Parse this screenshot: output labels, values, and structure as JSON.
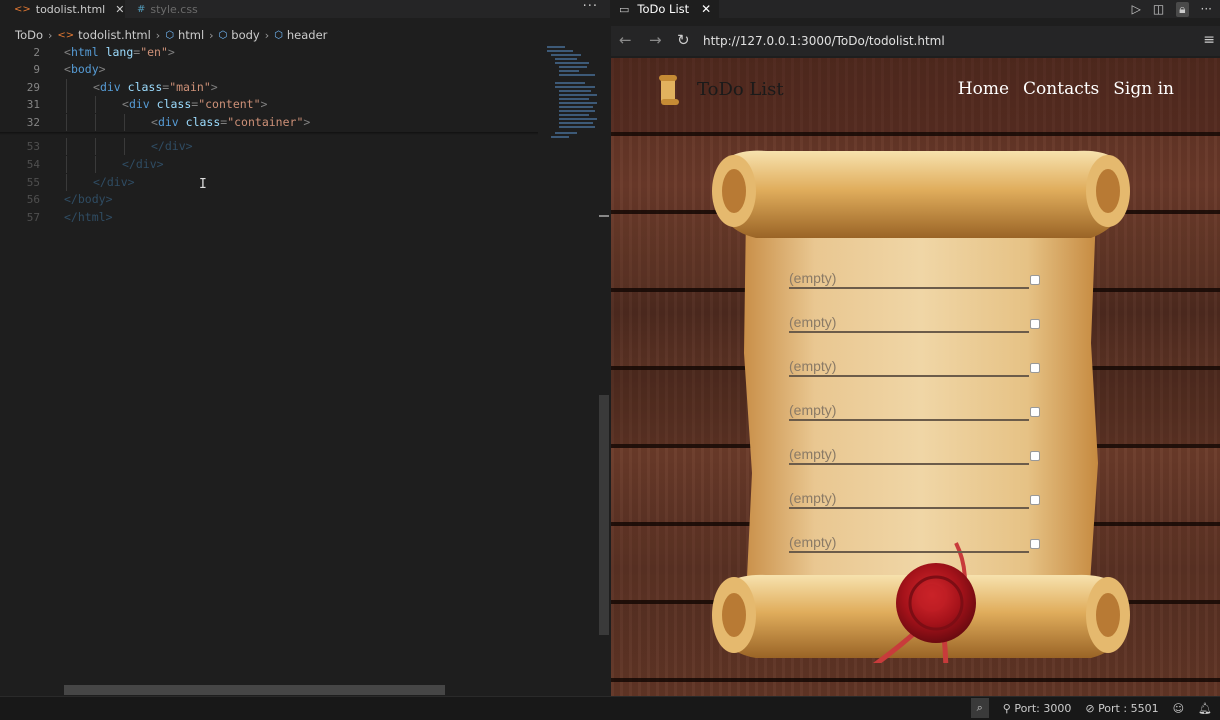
{
  "editor": {
    "tabs": [
      {
        "label": "todolist.html",
        "icon": "html-file-icon",
        "active": true
      },
      {
        "label": "style.css",
        "icon": "css-file-icon",
        "active": false
      }
    ],
    "breadcrumb": [
      "ToDo",
      "todolist.html",
      "html",
      "body",
      "header"
    ],
    "lines": [
      {
        "num": "2",
        "indent": 0,
        "parts": [
          [
            "pu",
            "<"
          ],
          [
            "tg",
            "html"
          ],
          [
            "at",
            " lang"
          ],
          [
            "pu",
            "="
          ],
          [
            "st",
            "\"en\""
          ],
          [
            "pu",
            ">"
          ]
        ]
      },
      {
        "num": "9",
        "indent": 0,
        "parts": [
          [
            "pu",
            "<"
          ],
          [
            "tg",
            "body"
          ],
          [
            "pu",
            ">"
          ]
        ]
      },
      {
        "num": "29",
        "indent": 1,
        "parts": [
          [
            "pu",
            "<"
          ],
          [
            "tg",
            "div"
          ],
          [
            "at",
            " class"
          ],
          [
            "pu",
            "="
          ],
          [
            "st",
            "\"main\""
          ],
          [
            "pu",
            ">"
          ]
        ]
      },
      {
        "num": "31",
        "indent": 2,
        "parts": [
          [
            "pu",
            "<"
          ],
          [
            "tg",
            "div"
          ],
          [
            "at",
            " class"
          ],
          [
            "pu",
            "="
          ],
          [
            "st",
            "\"content\""
          ],
          [
            "pu",
            ">"
          ]
        ]
      },
      {
        "num": "32",
        "indent": 3,
        "parts": [
          [
            "pu",
            "<"
          ],
          [
            "tg",
            "div"
          ],
          [
            "at",
            " class"
          ],
          [
            "pu",
            "="
          ],
          [
            "st",
            "\"container\""
          ],
          [
            "pu",
            ">"
          ]
        ]
      },
      {
        "num": "53",
        "indent": 3,
        "faded": true,
        "parts": [
          [
            "pu",
            "</"
          ],
          [
            "tg",
            "div"
          ],
          [
            "pu",
            ">"
          ]
        ]
      },
      {
        "num": "54",
        "indent": 2,
        "faded": true,
        "parts": [
          [
            "pu",
            "</"
          ],
          [
            "tg",
            "div"
          ],
          [
            "pu",
            ">"
          ]
        ]
      },
      {
        "num": "55",
        "indent": 1,
        "faded": true,
        "parts": [
          [
            "pu",
            "</"
          ],
          [
            "tg",
            "div"
          ],
          [
            "pu",
            ">"
          ]
        ]
      },
      {
        "num": "56",
        "indent": 0,
        "faded": true,
        "parts": [
          [
            "pu",
            "</"
          ],
          [
            "tg",
            "body"
          ],
          [
            "pu",
            ">"
          ]
        ]
      },
      {
        "num": "57",
        "indent": 0,
        "faded": true,
        "parts": [
          [
            "pu",
            "</"
          ],
          [
            "tg",
            "html"
          ],
          [
            "pu",
            ">"
          ]
        ]
      }
    ]
  },
  "browser": {
    "tab_title": "ToDo List",
    "url": "http://127.0.0.1:3000/ToDo/todolist.html",
    "page": {
      "logo_text": "ToDo List",
      "nav": [
        "Home",
        "Contacts",
        "Sign in"
      ],
      "todos": [
        "(empty)",
        "(empty)",
        "(empty)",
        "(empty)",
        "(empty)",
        "(empty)",
        "(empty)"
      ]
    }
  },
  "statusbar": {
    "port": "Port: 3000",
    "port2": "Port : 5501"
  },
  "colors": {
    "editor_bg": "#1e1e1e",
    "tag": "#569cd6",
    "attr": "#9cdcfe",
    "string": "#ce9178",
    "parchment": "#e8c48a",
    "wax_seal": "#b3141b"
  }
}
